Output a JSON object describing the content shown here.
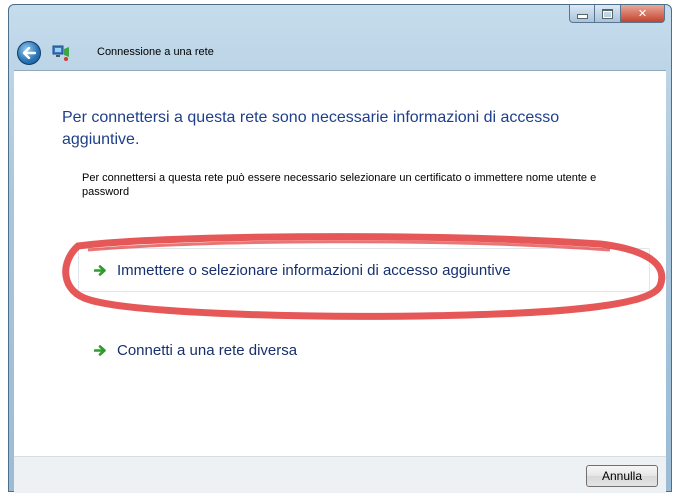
{
  "window": {
    "title": "",
    "caption_buttons": {
      "minimize": "minimize-icon",
      "maximize": "maximize-icon",
      "close": "close-icon"
    }
  },
  "nav": {
    "title": "Connessione a una rete",
    "back_icon": "back-arrow-icon",
    "app_icon": "network-icon"
  },
  "main": {
    "heading": "Per connettersi a questa rete sono necessarie informazioni di accesso aggiuntive.",
    "description": "Per connettersi a questa rete può essere necessario selezionare un certificato o immettere nome utente e password",
    "options": [
      {
        "label": "Immettere o selezionare informazioni di accesso aggiuntive",
        "icon": "green-arrow-icon",
        "highlighted": true
      },
      {
        "label": "Connetti a una rete diversa",
        "icon": "green-arrow-icon",
        "highlighted": false
      }
    ]
  },
  "footer": {
    "cancel_label": "Annulla"
  },
  "colors": {
    "heading": "#1f3f8c",
    "link": "#17306d",
    "annotation": "#e23a3a",
    "arrow": "#2e9d2e"
  }
}
